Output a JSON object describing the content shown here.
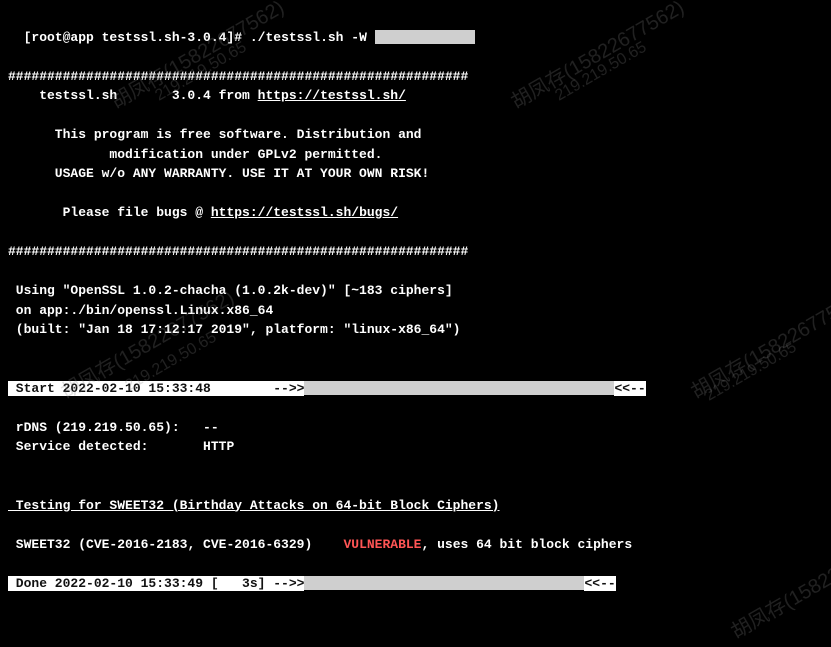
{
  "prompt": {
    "user_host": "[root@app testssl.sh-3.0.4]# ",
    "command": "./testssl.sh -W",
    "redacted_width": 100
  },
  "divider": "###########################################################",
  "banner": {
    "app_name": "    testssl.sh       ",
    "version_line": "3.0.4 from ",
    "url": "https://testssl.sh/",
    "line1": "      This program is free software. Distribution and",
    "line2": "             modification under GPLv2 permitted.",
    "line3": "      USAGE w/o ANY WARRANTY. USE IT AT YOUR OWN RISK!",
    "bugs_prefix": "       Please file bugs @ ",
    "bugs_url": "https://testssl.sh/bugs/"
  },
  "env": {
    "using": " Using \"OpenSSL 1.0.2-chacha (1.0.2k-dev)\" [~183 ciphers]",
    "on": " on app:./bin/openssl.Linux.x86_64",
    "built": " (built: \"Jan 18 17:12:17 2019\", platform: \"linux-x86_64\")"
  },
  "start_bar": {
    "prefix": " Start 2022-02-10 15:33:48        -->>",
    "redacted_width": 310,
    "suffix": "<<--"
  },
  "rdns": {
    "label": " rDNS (219.219.50.65):   ",
    "value": "--"
  },
  "service": {
    "label": " Service detected:       ",
    "value": "HTTP"
  },
  "test_header": " Testing for SWEET32 (Birthday Attacks on 64-bit Block Ciphers)",
  "sweet32": {
    "name": " SWEET32",
    "cve": " (CVE-2016-2183, CVE-2016-6329)    ",
    "status": "VULNERABLE",
    "detail": ", uses 64 bit block ciphers"
  },
  "done_bar": {
    "prefix": " Done 2022-02-10 15:33:49 [",
    "time": "   3s",
    "mid": "] -->>",
    "redacted_width": 280,
    "suffix": "<<--"
  },
  "watermarks": {
    "name": "胡凤存(15822677562)",
    "ip": "219.219.50.65"
  }
}
